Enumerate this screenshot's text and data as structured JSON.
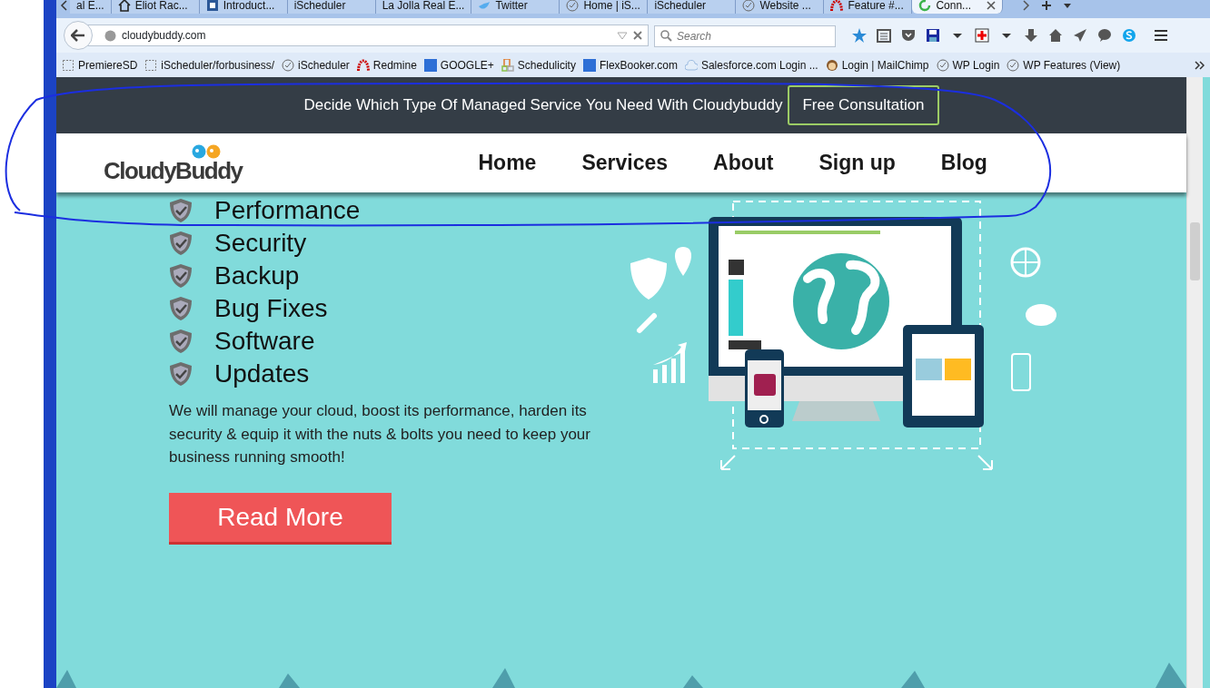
{
  "browser": {
    "tabs": [
      {
        "label": "al E...",
        "selected": false
      },
      {
        "label": "Eliot Rac...",
        "selected": false
      },
      {
        "label": "Introduct...",
        "selected": false
      },
      {
        "label": "iScheduler",
        "selected": false
      },
      {
        "label": "La Jolla Real E...",
        "selected": false
      },
      {
        "label": "Twitter",
        "selected": false
      },
      {
        "label": "Home | iS...",
        "selected": false
      },
      {
        "label": "iScheduler",
        "selected": false
      },
      {
        "label": "Website ...",
        "selected": false
      },
      {
        "label": "Feature #...",
        "selected": false
      },
      {
        "label": "Conn...",
        "selected": true
      }
    ],
    "address": "cloudybuddy.com",
    "search": {
      "placeholder": "Search"
    },
    "bookmarks": [
      {
        "label": "PremiereSD"
      },
      {
        "label": "iScheduler/forbusiness/"
      },
      {
        "label": "iScheduler"
      },
      {
        "label": "Redmine"
      },
      {
        "label": "GOOGLE+"
      },
      {
        "label": "Schedulicity"
      },
      {
        "label": "FlexBooker.com"
      },
      {
        "label": "Salesforce.com Login ..."
      },
      {
        "label": "Login | MailChimp"
      },
      {
        "label": "WP Login"
      },
      {
        "label": "WP Features (View)"
      }
    ]
  },
  "page": {
    "banner": {
      "text": "Decide Which Type Of Managed Service You Need With Cloudybuddy",
      "button": "Free Consultation"
    },
    "logo": "CloudyBuddy",
    "nav": [
      "Home",
      "Services",
      "About",
      "Sign up",
      "Blog"
    ],
    "features": [
      "Performance",
      "Security",
      "Backup",
      "Bug Fixes",
      "Software",
      "Updates"
    ],
    "description": "We will manage your cloud, boost its performance, harden its security & equip it with the nuts & bolts you need to keep your business running smooth!",
    "read_more": "Read More"
  }
}
